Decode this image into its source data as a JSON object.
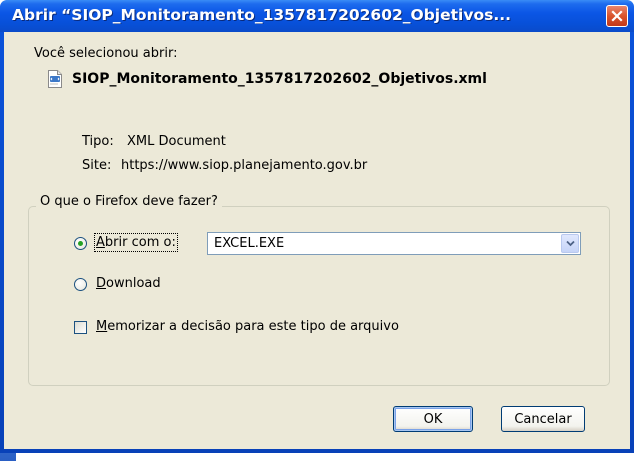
{
  "window": {
    "title": "Abrir “SIOP_Monitoramento_1357817202602_Objetivos..."
  },
  "dialog": {
    "intro": "Você selecionou abrir:",
    "filename": "SIOP_Monitoramento_1357817202602_Objetivos.xml",
    "file_icon": "xml-file-icon",
    "type_label": "Tipo:",
    "type_value": "XML Document",
    "site_label": "Site:",
    "site_value": "https://www.siop.planejamento.gov.br"
  },
  "action_group": {
    "legend": "O que o Firefox deve fazer?",
    "open_with": {
      "label_first": "A",
      "label_rest": "brir com o:",
      "selected": true,
      "app_value": "EXCEL.EXE"
    },
    "download": {
      "label_first": "D",
      "label_rest": "ownload",
      "selected": false
    },
    "remember": {
      "label_first": "M",
      "label_rest": "emorizar a decisão para este tipo de arquivo",
      "checked": false
    }
  },
  "buttons": {
    "ok": "OK",
    "cancel": "Cancelar"
  },
  "colors": {
    "titlebar": "#0a53dc",
    "dialog_bg": "#ece9d8",
    "close_button": "#d9542c",
    "radio_dot": "#24a124"
  }
}
